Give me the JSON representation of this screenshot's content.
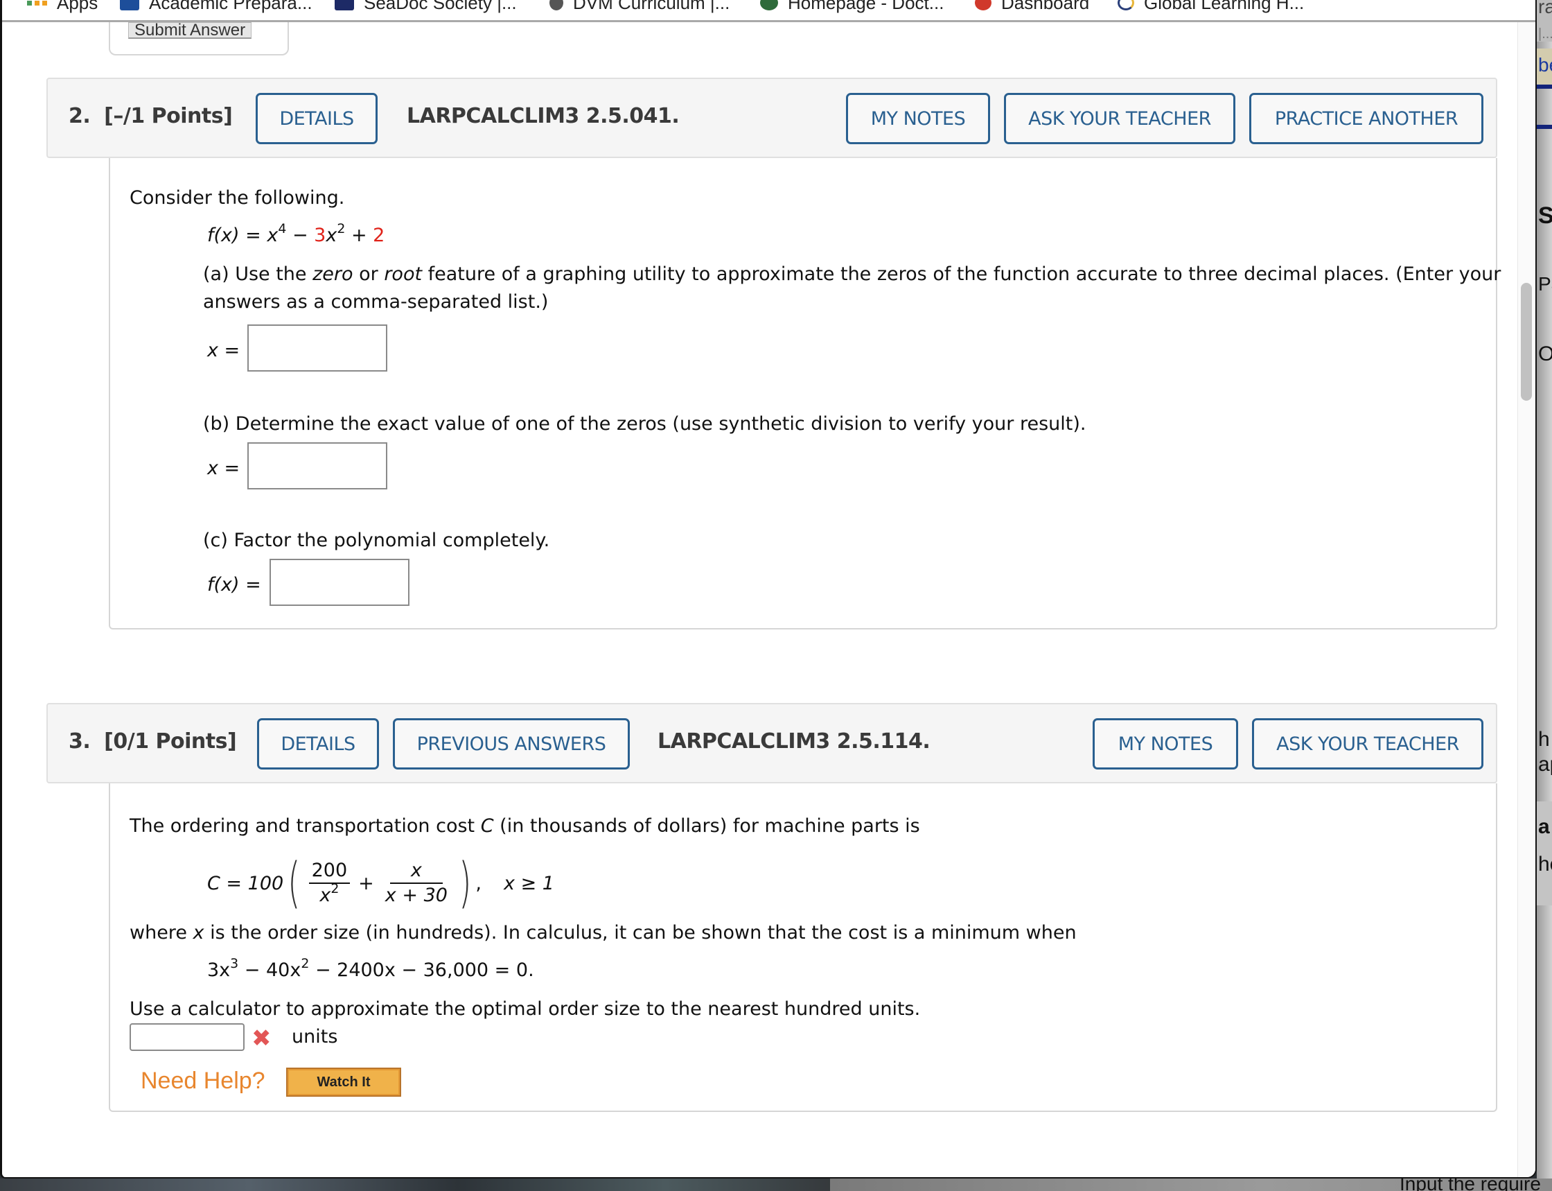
{
  "bookmarks": [
    {
      "label": "Apps",
      "icon": "apps-grid-icon"
    },
    {
      "label": "Academic Prepara...",
      "icon": "academic-favicon"
    },
    {
      "label": "SeaDoc Society |...",
      "icon": "seadoc-favicon"
    },
    {
      "label": "DVM Curriculum |...",
      "icon": "dvm-favicon"
    },
    {
      "label": "Homepage - Doct...",
      "icon": "homepage-favicon"
    },
    {
      "label": "Dashboard",
      "icon": "dashboard-favicon"
    },
    {
      "label": "Global Learning H...",
      "icon": "global-learning-favicon"
    }
  ],
  "previous_question": {
    "submit_label": "Submit Answer"
  },
  "questions": [
    {
      "number": "2.",
      "points": "[–/1 Points]",
      "details_label": "DETAILS",
      "code": "LARPCALCLIM3 2.5.041.",
      "my_notes_label": "MY NOTES",
      "ask_teacher_label": "ASK YOUR TEACHER",
      "practice_label": "PRACTICE ANOTHER",
      "intro": "Consider the following.",
      "function": {
        "lhs": "f(x) = x",
        "exp1": "4",
        "minus": " − ",
        "coef": "3",
        "x2": "x",
        "exp2": "2",
        "plus": " + ",
        "const": "2"
      },
      "part_a": {
        "text_prefix": "(a) Use the ",
        "em1": "zero",
        "mid": " or ",
        "em2": "root",
        "text_suffix": " feature of a graphing utility to approximate the zeros of the function accurate to three decimal places. (Enter your",
        "line2": "answers as a comma-separated list.)",
        "label": "x =",
        "value": ""
      },
      "part_b": {
        "text": "(b) Determine the exact value of one of the zeros (use synthetic division to verify your result).",
        "label": "x =",
        "value": ""
      },
      "part_c": {
        "text": "(c) Factor the polynomial completely.",
        "label": "f(x) =",
        "value": ""
      }
    },
    {
      "number": "3.",
      "points": "[0/1 Points]",
      "details_label": "DETAILS",
      "previous_answers_label": "PREVIOUS ANSWERS",
      "code": "LARPCALCLIM3 2.5.114.",
      "my_notes_label": "MY NOTES",
      "ask_teacher_label": "ASK YOUR TEACHER",
      "intro_prefix": "The ordering and transportation cost ",
      "intro_var": "C",
      "intro_suffix": " (in thousands of dollars) for machine parts is",
      "formula": {
        "lhs": "C = 100",
        "frac1_num": "200",
        "frac1_den": "x",
        "frac1_den_exp": "2",
        "plus": "+",
        "frac2_num": "x",
        "frac2_den": "x + 30",
        "comma": ",",
        "domain": "x ≥ 1"
      },
      "where_prefix": "where ",
      "where_var": "x",
      "where_suffix": " is the order size (in hundreds). In calculus, it can be shown that the cost is a minimum when",
      "equation": {
        "t1": "3x",
        "e1": "3",
        "t2": " − 40x",
        "e2": "2",
        "t3": " − 2400x − 36,000 = 0."
      },
      "instruction": "Use a calculator to approximate the optimal order size to the nearest hundred units.",
      "answer_value": "",
      "answer_status": "incorrect",
      "units_label": "units",
      "need_help_label": "Need Help?",
      "watch_it_label": "Watch It"
    }
  ],
  "background_window": {
    "fragments": [
      "ra",
      "|...",
      "be",
      "S",
      "Pa",
      "O",
      "h",
      "ap",
      "a",
      "he"
    ],
    "bottom_text": "Input the require"
  },
  "colors": {
    "accent_blue": "#2a6090",
    "red_value": "#e0231a",
    "help_orange": "#e8862e",
    "watch_button": "#f0b24a"
  }
}
